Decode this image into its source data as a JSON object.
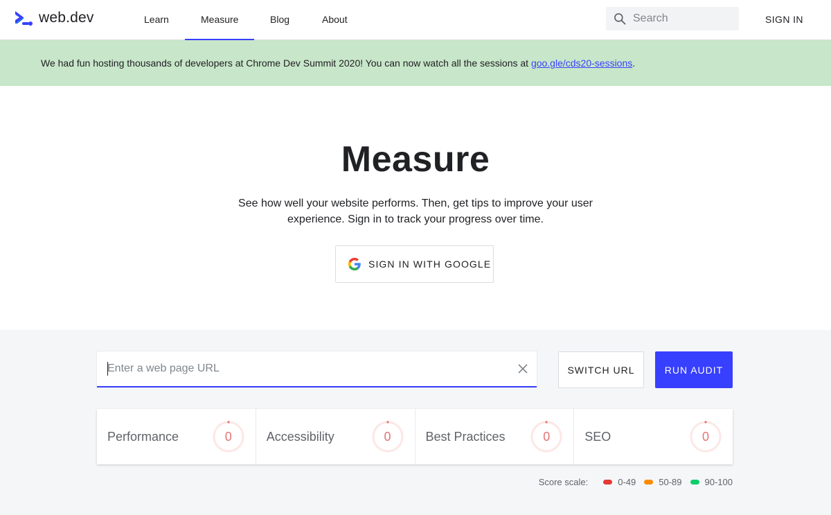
{
  "header": {
    "logo_text": "web.dev",
    "nav": [
      {
        "label": "Learn"
      },
      {
        "label": "Measure",
        "active": true
      },
      {
        "label": "Blog"
      },
      {
        "label": "About"
      }
    ],
    "search_placeholder": "Search",
    "sign_in": "SIGN IN"
  },
  "banner": {
    "text": "We had fun hosting thousands of developers at Chrome Dev Summit 2020! You can now watch all the sessions at ",
    "link_text": "goo.gle/cds20-sessions",
    "suffix": "."
  },
  "hero": {
    "title": "Measure",
    "description": "See how well your website performs. Then, get tips to improve your user experience. Sign in to track your progress over time.",
    "google_button": "SIGN IN WITH GOOGLE"
  },
  "audit": {
    "url_placeholder": "Enter a web page URL",
    "switch_url": "SWITCH URL",
    "run_audit": "RUN AUDIT"
  },
  "scores": [
    {
      "label": "Performance",
      "value": "0"
    },
    {
      "label": "Accessibility",
      "value": "0"
    },
    {
      "label": "Best Practices",
      "value": "0"
    },
    {
      "label": "SEO",
      "value": "0"
    }
  ],
  "score_scale": {
    "label": "Score scale:",
    "items": [
      {
        "range": "0-49",
        "color": "#e53935"
      },
      {
        "range": "50-89",
        "color": "#fb8c00"
      },
      {
        "range": "90-100",
        "color": "#0cce6b"
      }
    ]
  },
  "colors": {
    "accent": "#3740ff",
    "banner_bg": "#c8e6c9",
    "score_fail": "#e57373"
  }
}
